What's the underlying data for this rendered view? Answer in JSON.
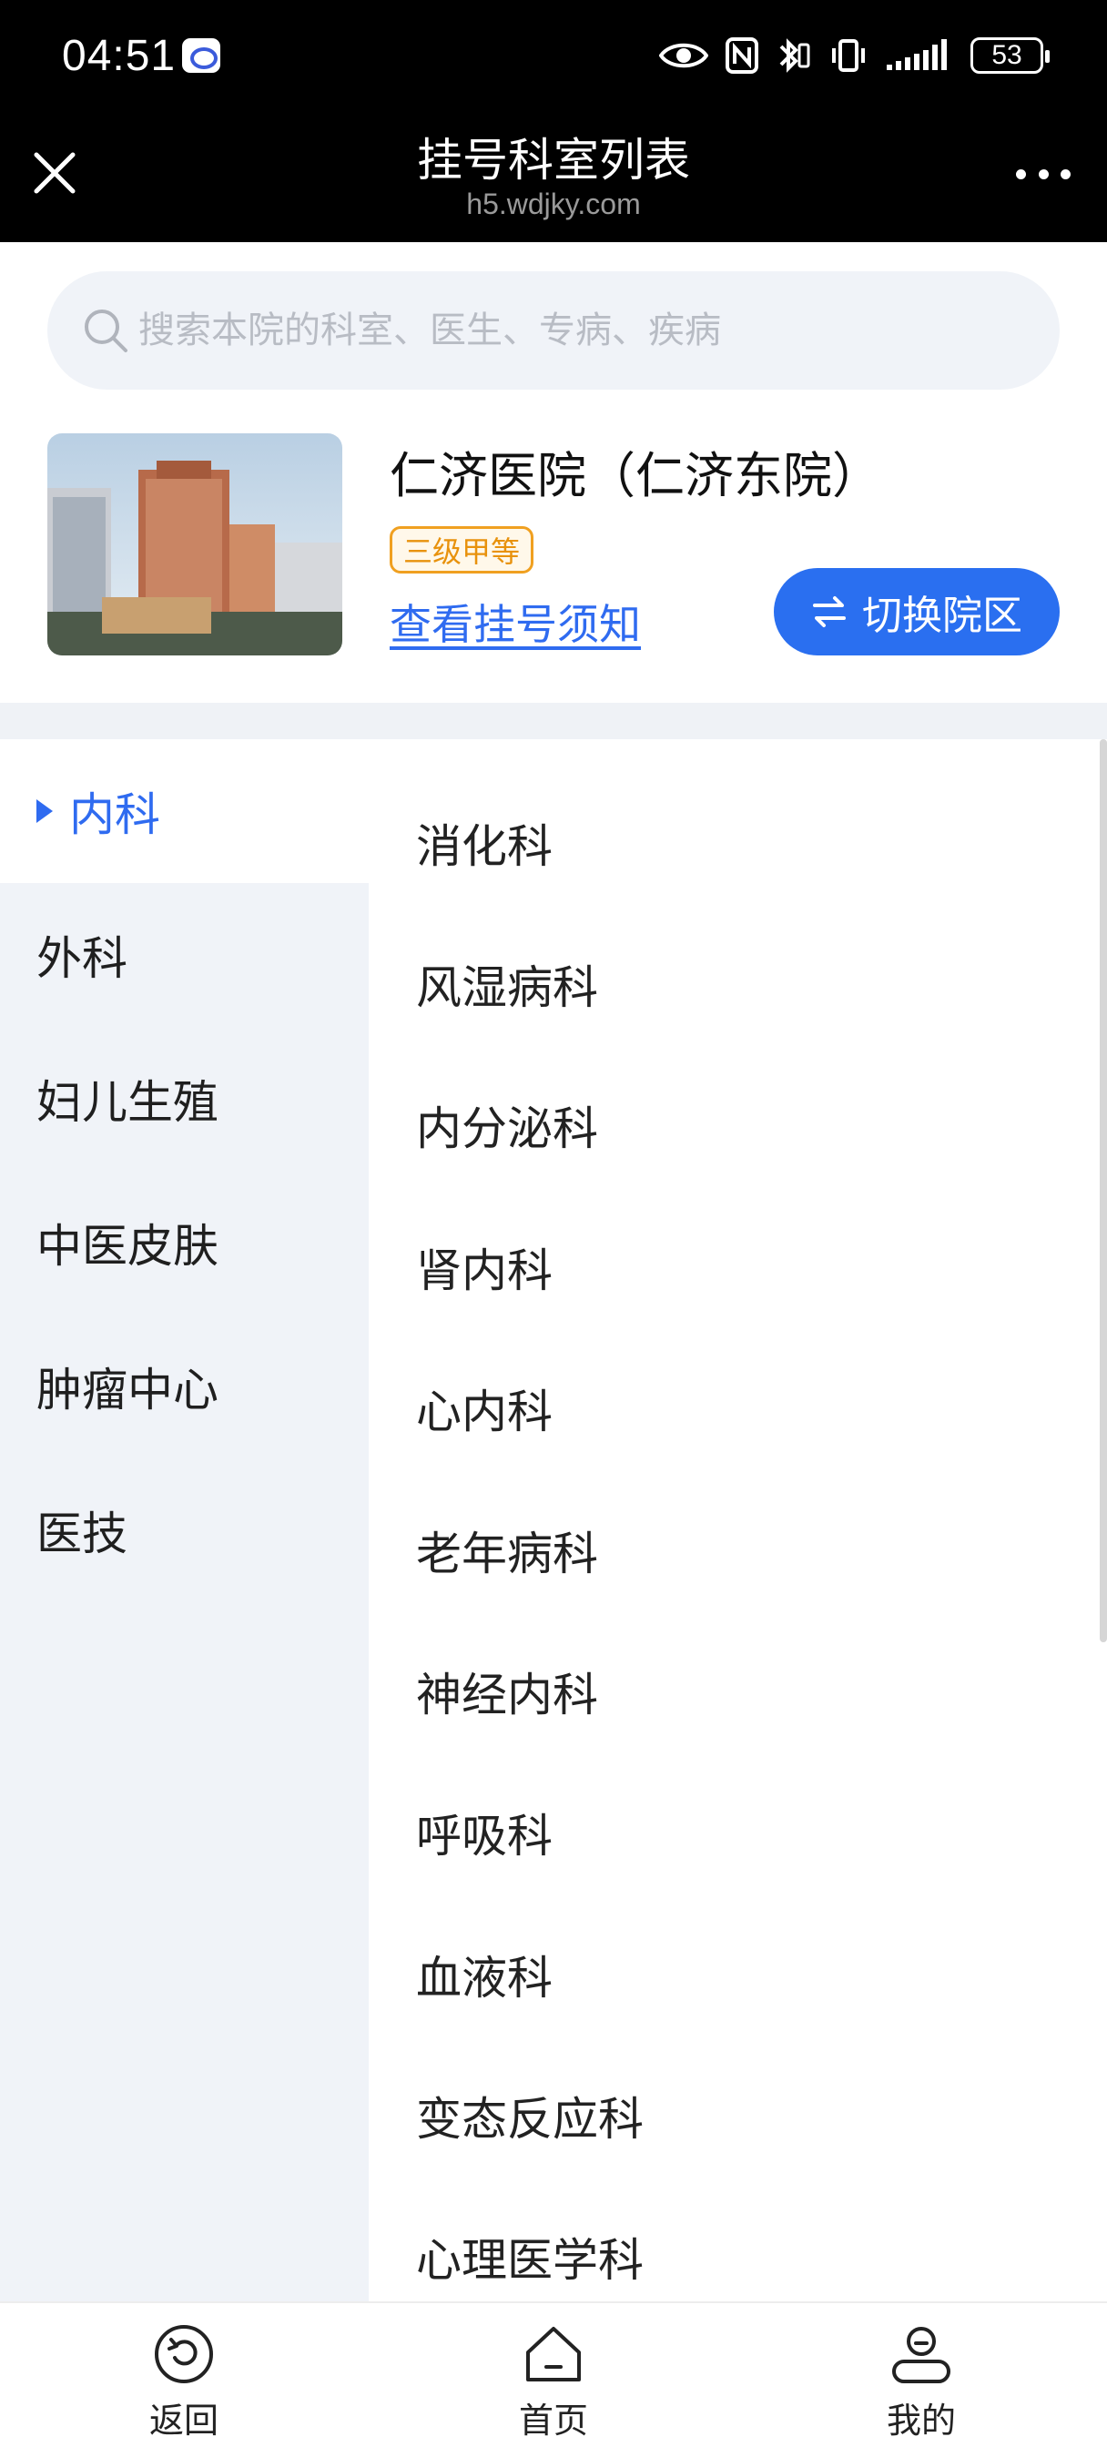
{
  "status_bar": {
    "time": "04:51",
    "battery": "53"
  },
  "titlebar": {
    "title": "挂号科室列表",
    "domain": "h5.wdjky.com"
  },
  "search": {
    "placeholder": "搜索本院的科室、医生、专病、疾病"
  },
  "hospital": {
    "name": "仁济医院（仁济东院）",
    "level_badge": "三级甲等",
    "notice_link": "查看挂号须知",
    "switch_label": "切换院区"
  },
  "categories": [
    {
      "label": "内科",
      "active": true
    },
    {
      "label": "外科",
      "active": false
    },
    {
      "label": "妇儿生殖",
      "active": false
    },
    {
      "label": "中医皮肤",
      "active": false
    },
    {
      "label": "肿瘤中心",
      "active": false
    },
    {
      "label": "医技",
      "active": false
    }
  ],
  "departments": [
    "消化科",
    "风湿病科",
    "内分泌科",
    "肾内科",
    "心内科",
    "老年病科",
    "神经内科",
    "呼吸科",
    "血液科",
    "变态反应科",
    "心理医学科"
  ],
  "bottom_nav": [
    {
      "label": "返回",
      "icon": "back-icon"
    },
    {
      "label": "首页",
      "icon": "home-icon"
    },
    {
      "label": "我的",
      "icon": "profile-icon"
    }
  ],
  "colors": {
    "accent": "#2f6bf0",
    "badge": "#e8920d",
    "sidebar_bg": "#f0f3f8"
  }
}
